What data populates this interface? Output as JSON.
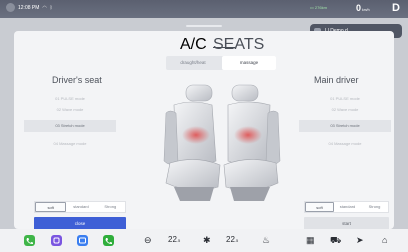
{
  "status_bar": {
    "time": "12:08 PM",
    "range": "276km",
    "speed": "0",
    "speed_unit": "km/h",
    "gear": "D"
  },
  "mini_app": {
    "label": "Ll Demo d"
  },
  "tabs": [
    {
      "label": "A/C",
      "selected": false
    },
    {
      "label": "SEATS",
      "selected": true
    }
  ],
  "segment": {
    "options": [
      "draught/heat",
      "massage"
    ],
    "selected": "massage"
  },
  "driver": {
    "title": "Driver's seat",
    "modes": [
      "01 PULSE mode",
      "02 Wave mode",
      "03 Stretch mode",
      "04 Massage mode"
    ],
    "selected_mode": "03 Stretch mode",
    "strength_options": [
      "soft",
      "standard",
      "Strong"
    ],
    "strength_selected": "soft",
    "action_label": "close"
  },
  "main_driver": {
    "title": "Main driver",
    "modes": [
      "01 PULSE mode",
      "02 Wave mode",
      "03 Stretch mode",
      "04 Massage mode"
    ],
    "selected_mode": "03 Stretch mode",
    "strength_options": [
      "soft",
      "standard",
      "Strong"
    ],
    "strength_selected": "soft",
    "action_label": "start"
  },
  "dock": {
    "temp_left": "22",
    "temp_left_decimal": ".5",
    "temp_right": "22",
    "temp_right_decimal": ".5",
    "icons": [
      "phone-icon",
      "purple-app-icon",
      "blue-app-icon",
      "green-phone-icon",
      "car-link-icon",
      "fan-icon",
      "seat-heat-icon",
      "apps-grid-icon",
      "car-icon",
      "navigation-icon",
      "home-icon"
    ]
  },
  "colors": {
    "accent_blue": "#3e5fd6",
    "panel_bg": "#f3f4f6",
    "status_bar": "#5b6070",
    "heat_red": "#e05050"
  }
}
